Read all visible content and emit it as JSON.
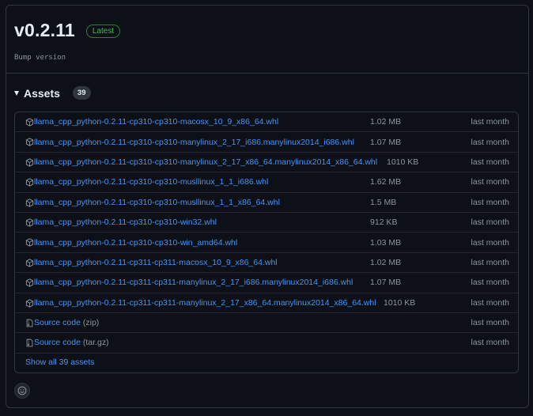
{
  "release": {
    "version": "v0.2.11",
    "badge": "Latest",
    "commit_message": "Bump version"
  },
  "assets": {
    "title": "Assets",
    "count": "39",
    "items": [
      {
        "name": "llama_cpp_python-0.2.11-cp310-cp310-macosx_10_9_x86_64.whl",
        "size": "1.02 MB",
        "date": "last month",
        "icon": "package-icon"
      },
      {
        "name": "llama_cpp_python-0.2.11-cp310-cp310-manylinux_2_17_i686.manylinux2014_i686.whl",
        "size": "1.07 MB",
        "date": "last month",
        "icon": "package-icon"
      },
      {
        "name": "llama_cpp_python-0.2.11-cp310-cp310-manylinux_2_17_x86_64.manylinux2014_x86_64.whl",
        "size": "1010 KB",
        "date": "last month",
        "icon": "package-icon"
      },
      {
        "name": "llama_cpp_python-0.2.11-cp310-cp310-musllinux_1_1_i686.whl",
        "size": "1.62 MB",
        "date": "last month",
        "icon": "package-icon"
      },
      {
        "name": "llama_cpp_python-0.2.11-cp310-cp310-musllinux_1_1_x86_64.whl",
        "size": "1.5 MB",
        "date": "last month",
        "icon": "package-icon"
      },
      {
        "name": "llama_cpp_python-0.2.11-cp310-cp310-win32.whl",
        "size": "912 KB",
        "date": "last month",
        "icon": "package-icon"
      },
      {
        "name": "llama_cpp_python-0.2.11-cp310-cp310-win_amd64.whl",
        "size": "1.03 MB",
        "date": "last month",
        "icon": "package-icon"
      },
      {
        "name": "llama_cpp_python-0.2.11-cp311-cp311-macosx_10_9_x86_64.whl",
        "size": "1.02 MB",
        "date": "last month",
        "icon": "package-icon"
      },
      {
        "name": "llama_cpp_python-0.2.11-cp311-cp311-manylinux_2_17_i686.manylinux2014_i686.whl",
        "size": "1.07 MB",
        "date": "last month",
        "icon": "package-icon"
      },
      {
        "name": "llama_cpp_python-0.2.11-cp311-cp311-manylinux_2_17_x86_64.manylinux2014_x86_64.whl",
        "size": "1010 KB",
        "date": "last month",
        "icon": "package-icon"
      }
    ],
    "source": [
      {
        "label": "Source code",
        "suffix": "(zip)",
        "date": "last month",
        "icon": "file-zip-icon"
      },
      {
        "label": "Source code",
        "suffix": "(tar.gz)",
        "date": "last month",
        "icon": "file-zip-icon"
      }
    ],
    "show_all": "Show all 39 assets"
  },
  "colors": {
    "background": "#0d1117",
    "border": "#30363d",
    "link": "#4493f8",
    "muted": "#8b949e",
    "latest_green": "#3fb950"
  }
}
